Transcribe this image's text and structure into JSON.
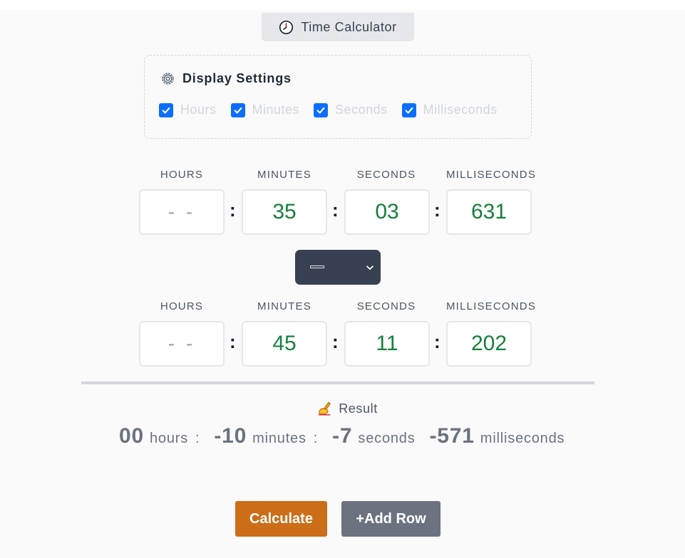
{
  "header": {
    "title": "Time Calculator",
    "icon": "clock-icon"
  },
  "settings": {
    "title": "Display Settings",
    "icon": "gear-icon",
    "options": [
      {
        "label": "Hours",
        "checked": true
      },
      {
        "label": "Minutes",
        "checked": true
      },
      {
        "label": "Seconds",
        "checked": true
      },
      {
        "label": "Milliseconds",
        "checked": true
      }
    ],
    "check_color": "#0d6efd"
  },
  "row1": {
    "labels": [
      "HOURS",
      "MINUTES",
      "SECONDS",
      "MILLISECONDS"
    ],
    "values": [
      "- -",
      "35",
      "03",
      "631"
    ]
  },
  "operator": {
    "selected": "—",
    "icon": "chevron-down-icon"
  },
  "row2": {
    "labels": [
      "HOURS",
      "MINUTES",
      "SECONDS",
      "MILLISECONDS"
    ],
    "values": [
      "- -",
      "45",
      "11",
      "202"
    ]
  },
  "result": {
    "title": "Result",
    "icon": "writing-hand-icon",
    "hours": "00",
    "hours_unit": "hours",
    "minutes": "-10",
    "minutes_unit": "minutes",
    "seconds": "-7",
    "seconds_unit": "seconds",
    "milliseconds": "-571",
    "milliseconds_unit": "milliseconds",
    "separator": ":"
  },
  "buttons": {
    "calculate": "Calculate",
    "add_row": "+Add Row",
    "calculate_color": "#cc6d18",
    "add_row_color": "#6b7280"
  },
  "colors": {
    "value_green": "#15803d",
    "accent_dark": "#374151"
  }
}
